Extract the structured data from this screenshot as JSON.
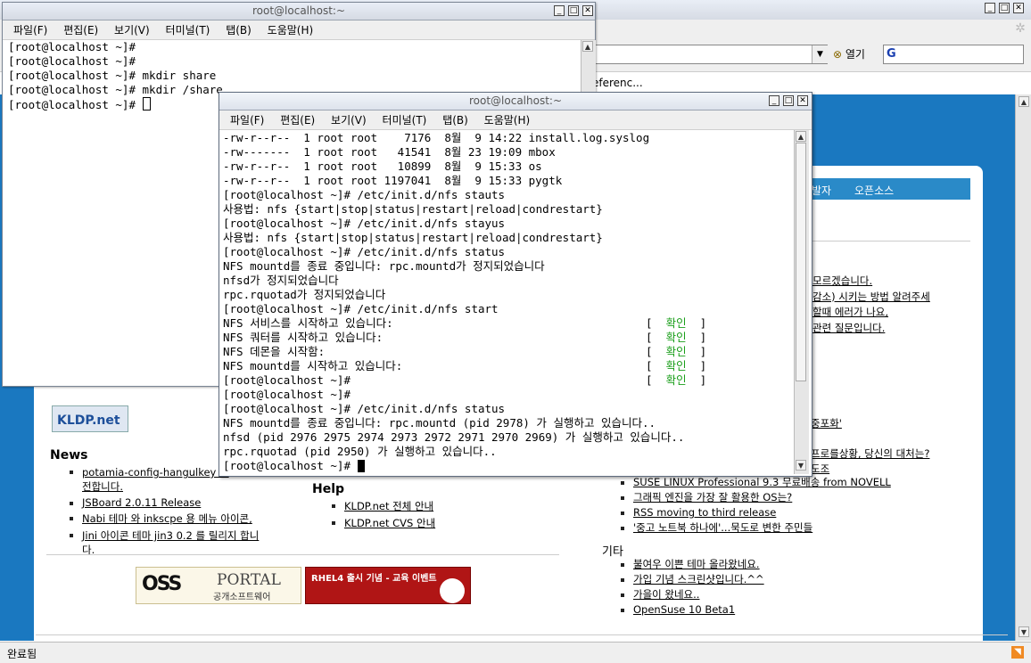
{
  "browser": {
    "open_label": "열기",
    "link_fragment": "eferenc...",
    "tab_partial": "발자",
    "tab_opensource": "오픈소스",
    "status_text": "완료됨",
    "right_links": [
      "모르겠습니다.",
      "감소) 시키는 방법 알려주세",
      "할때 에러가 나요,",
      "관련 질문입니다."
    ],
    "right_links2": [
      "중포화'",
      "프로를상황, 당신의 대처는?",
      "도조"
    ],
    "news_title": "News",
    "news_items": [
      "potamia-config-hangulkey 데",
      "전합니다.",
      "JSBoard 2.0.11 Release",
      "Nabi 테마 와 inkscpe 용 메뉴 아이콘,",
      "Jini 아이콘 테마 jin3 0.2 를 릴리지 합니",
      "다."
    ],
    "help_title": "Help",
    "help_items": [
      "KLDP.net 전체 안내",
      "KLDP.net CVS 안내"
    ],
    "center_items": [
      "SUSE LINUX Professional 9.3 무료배송 from NOVELL",
      "그래픽 엔진을 가장 잘 활용한 OS는?",
      "RSS moving to third release",
      "'중고 노트북 하나에'...묵도로 변한 주민들"
    ],
    "etc_title": "기타",
    "etc_items": [
      "불여우 이쁜 테마 올라왔네요.",
      "가입 기념 스크린샷입니다.^^",
      "가을이 왔네요..",
      "OpenSuse 10 Beta1"
    ],
    "kldp_logo": "KLDP.net",
    "oss_logo_text": "PORTAL",
    "oss_logo_sub": "공개소프트웨어",
    "rhel_banner": "RHEL4 출시 기념 - 교육 이벤트"
  },
  "term1": {
    "title": "root@localhost:~",
    "menu": [
      "파일(F)",
      "편집(E)",
      "보기(V)",
      "터미널(T)",
      "탭(B)",
      "도움말(H)"
    ],
    "lines": [
      "[root@localhost ~]#",
      "[root@localhost ~]#",
      "[root@localhost ~]# mkdir share",
      "[root@localhost ~]# mkdir /share",
      "[root@localhost ~]# "
    ]
  },
  "term2": {
    "title": "root@localhost:~",
    "menu": [
      "파일(F)",
      "편집(E)",
      "보기(V)",
      "터미널(T)",
      "탭(B)",
      "도움말(H)"
    ],
    "lines": [
      "-rw-r--r--  1 root root    7176  8월  9 14:22 install.log.syslog",
      "-rw-------  1 root root   41541  8월 23 19:09 mbox",
      "-rw-r--r--  1 root root   10899  8월  9 15:33 os",
      "-rw-r--r--  1 root root 1197041  8월  9 15:33 pygtk",
      "[root@localhost ~]# /etc/init.d/nfs stauts",
      "사용법: nfs {start|stop|status|restart|reload|condrestart}",
      "[root@localhost ~]# /etc/init.d/nfs stayus",
      "사용법: nfs {start|stop|status|restart|reload|condrestart}",
      "[root@localhost ~]# /etc/init.d/nfs status",
      "NFS mountd를 종료 중입니다: rpc.mountd가 정지되었습니다",
      "nfsd가 정지되었습니다",
      "rpc.rquotad가 정지되었습니다",
      "[root@localhost ~]# /etc/init.d/nfs start"
    ],
    "service_lines": [
      "NFS 서비스를 시작하고 있습니다:",
      "NFS 쿼터를 시작하고 있습니다:",
      "NFS 데몬을 시작함:",
      "NFS mountd를 시작하고 있습니다:"
    ],
    "ok_label": "확인",
    "tail_lines": [
      "[root@localhost ~]#",
      "[root@localhost ~]# /etc/init.d/nfs status",
      "NFS mountd를 종료 중입니다: rpc.mountd (pid 2978) 가 실행하고 있습니다..",
      "nfsd (pid 2976 2975 2974 2973 2972 2971 2970 2969) 가 실행하고 있습니다..",
      "rpc.rquotad (pid 2950) 가 실행하고 있습니다..",
      "[root@localhost ~]# "
    ]
  }
}
